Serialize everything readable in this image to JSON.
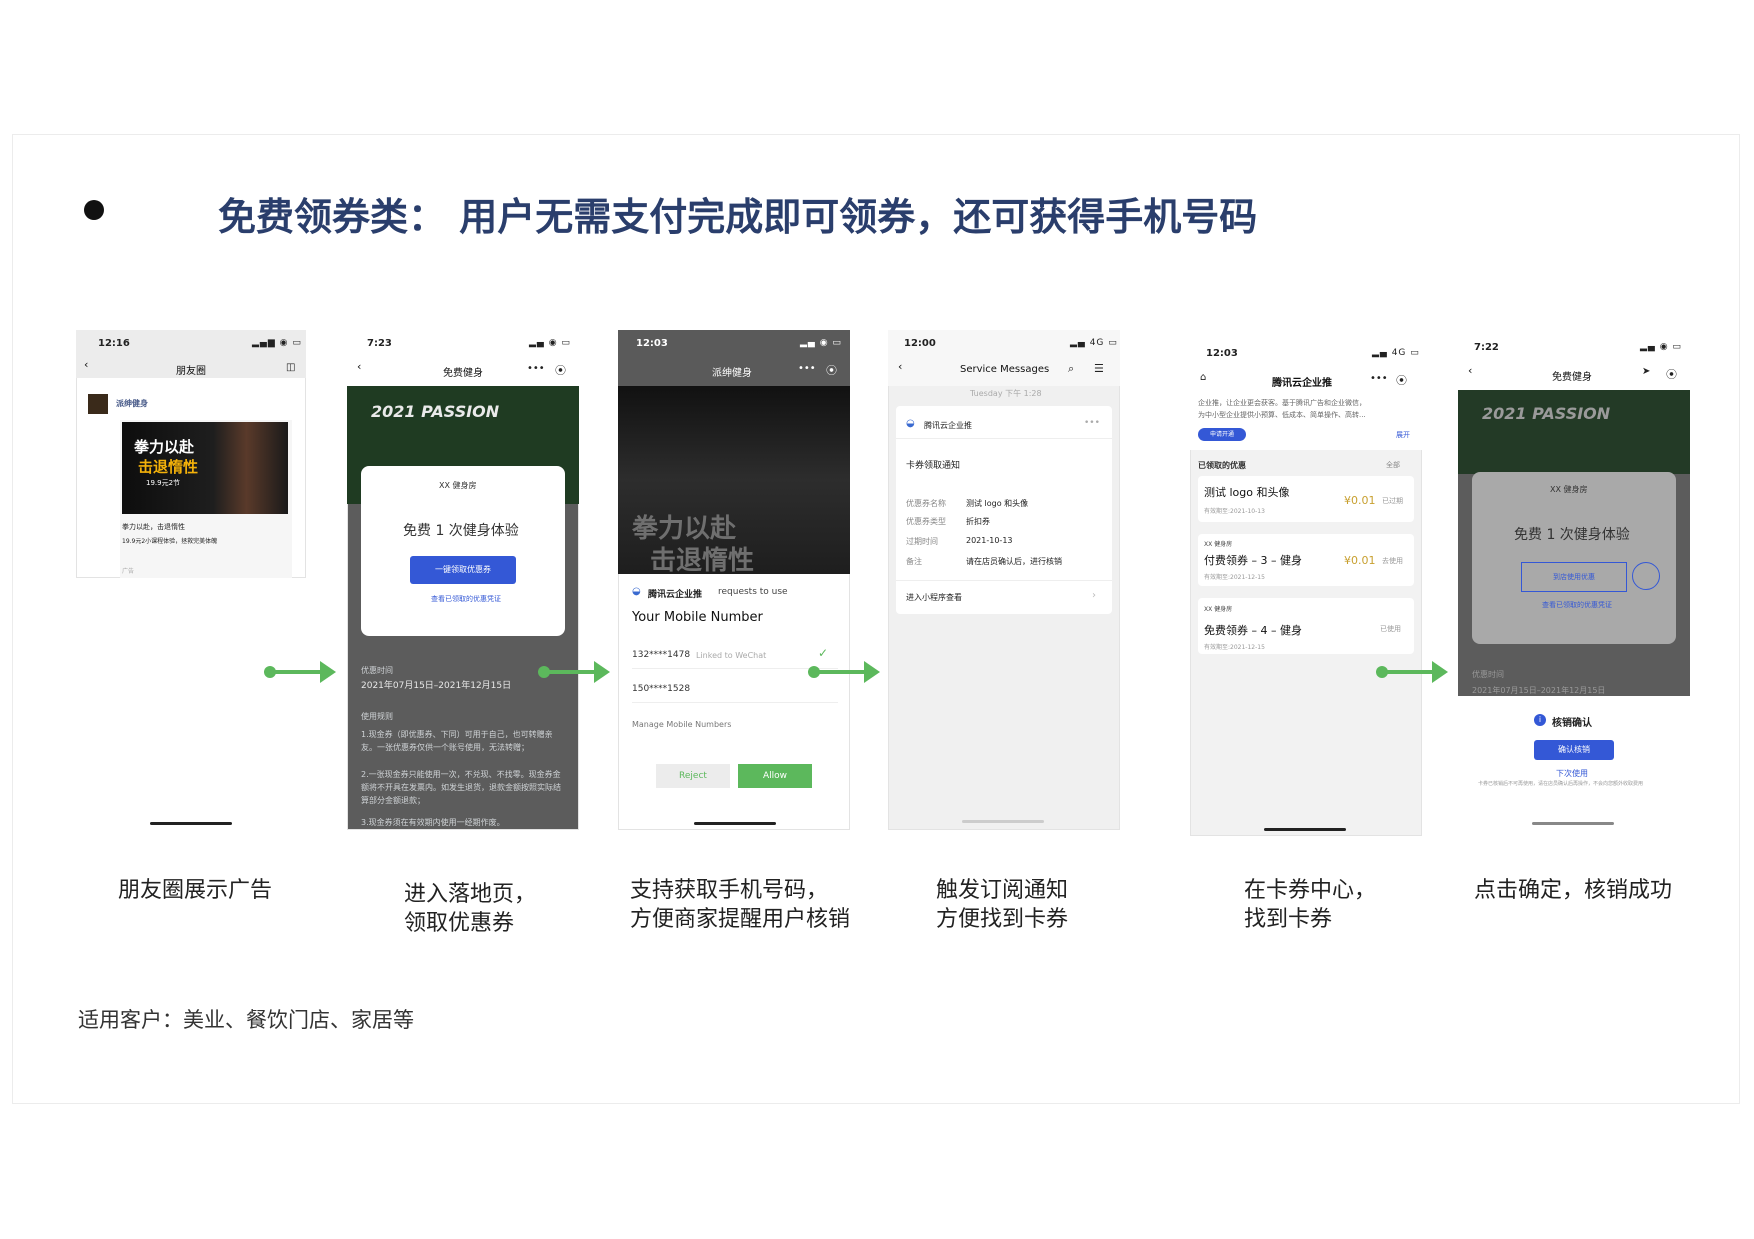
{
  "title": "免费领券类： 用户无需支付完成即可领券，还可获得手机号码",
  "note": "适用客户：美业、餐饮门店、家居等",
  "captions": [
    {
      "line1": "朋友圈展示广告",
      "line2": ""
    },
    {
      "line1": "进入落地页，",
      "line2": "领取优惠券"
    },
    {
      "line1": "支持获取手机号码，",
      "line2": "方便商家提醒用户核销"
    },
    {
      "line1": "触发订阅通知",
      "line2": "方便找到卡券"
    },
    {
      "line1": "在卡券中心，",
      "line2": "找到卡券"
    },
    {
      "line1": "点击确定，核销成功",
      "line2": ""
    }
  ],
  "phone1": {
    "time": "12:16",
    "nav_title": "朋友圈",
    "account": "派绅健身",
    "ad_line1": "拳力以赴",
    "ad_line2": "击退惰性",
    "ad_price": "19.9元2节",
    "ad_text": "拳力以赴，击退惰性",
    "ad_sub": "19.9元2小课程体验，拯救完美体魄",
    "ad_label": "广告"
  },
  "phone2": {
    "time": "7:23",
    "nav_title": "免费健身",
    "banner": "2021 PASSION",
    "brand": "XX 健身房",
    "offer": "免费 1 次健身体验",
    "claim_button": "一键领取优惠券",
    "link": "查看已领取的优惠凭证",
    "period_label": "优惠时间",
    "period_value": "2021年07月15日–2021年12月15日",
    "rules_label": "使用规则",
    "rule1": "1.现金券（即优惠券、下同）可用于自己，也可转赠亲友。一张优惠券仅供一个账号使用，无法转赠；",
    "rule2": "2.一张现金券只能使用一次，不兑现、不找零。现金券金额将不开具在发票内。如发生退货，退款金额按照实际结算部分金额退款；",
    "rule3": "3.现金券须在有效期内使用一经期作废。"
  },
  "phone3": {
    "time": "12:03",
    "nav_title": "派绅健身",
    "poster1": "拳力以赴",
    "poster2": "击退惰性",
    "requester": "腾讯云企业推",
    "requests": "requests to use",
    "heading": "Your Mobile Number",
    "num1": "132****1478",
    "linked": "Linked to WeChat",
    "num2": "150****1528",
    "manage": "Manage Mobile Numbers",
    "reject": "Reject",
    "allow": "Allow"
  },
  "phone4": {
    "time": "12:00",
    "nav_title": "Service Messages",
    "date": "Tuesday 下午 1:28",
    "sender": "腾讯云企业推",
    "msg_title": "卡券领取通知",
    "k1": "优惠券名称",
    "v1": "测试 logo 和头像",
    "k2": "优惠券类型",
    "v2": "折扣券",
    "k3": "过期时间",
    "v3": "2021-10-13",
    "k4": "备注",
    "v4": "请在店员确认后，进行核销",
    "enter": "进入小程序查看"
  },
  "phone5": {
    "time": "12:03",
    "nav_title": "腾讯云企业推",
    "desc1": "企业推，让企业更会获客。基于腾讯广告和企业微信，",
    "desc2": "为中小型企业提供小预算、低成本、简单操作、高转...",
    "apply": "申请开通",
    "expand": "展开",
    "section": "已领取的优惠",
    "filter": "全部",
    "c1_title": "测试 logo 和头像",
    "c1_price": "¥0.01",
    "c1_status": "已过期",
    "c1_date": "有效期至:2021-10-13",
    "c2_brand": "XX 健身房",
    "c2_title": "付费领券 – 3 – 健身",
    "c2_price": "¥0.01",
    "c2_status": "去使用",
    "c2_date": "有效期至:2021-12-15",
    "c3_brand": "XX 健身房",
    "c3_title": "免费领券 – 4 – 健身",
    "c3_status": "已使用",
    "c3_date": "有效期至:2021-12-15"
  },
  "phone6": {
    "time": "7:22",
    "nav_title": "免费健身",
    "banner": "2021 PASSION",
    "brand": "XX 健身房",
    "offer": "免费 1 次健身体验",
    "use_button": "到店使用优惠",
    "link": "查看已领取的优惠凭证",
    "period_label": "优惠时间",
    "period_value": "2021年07月15日–2021年12月15日",
    "confirm_title": "核销确认",
    "confirm_button": "确认核销",
    "later": "下次使用",
    "tip": "卡券已核销后不可再使用，请在店员确认后再操作，不会向您额外收取费用"
  }
}
